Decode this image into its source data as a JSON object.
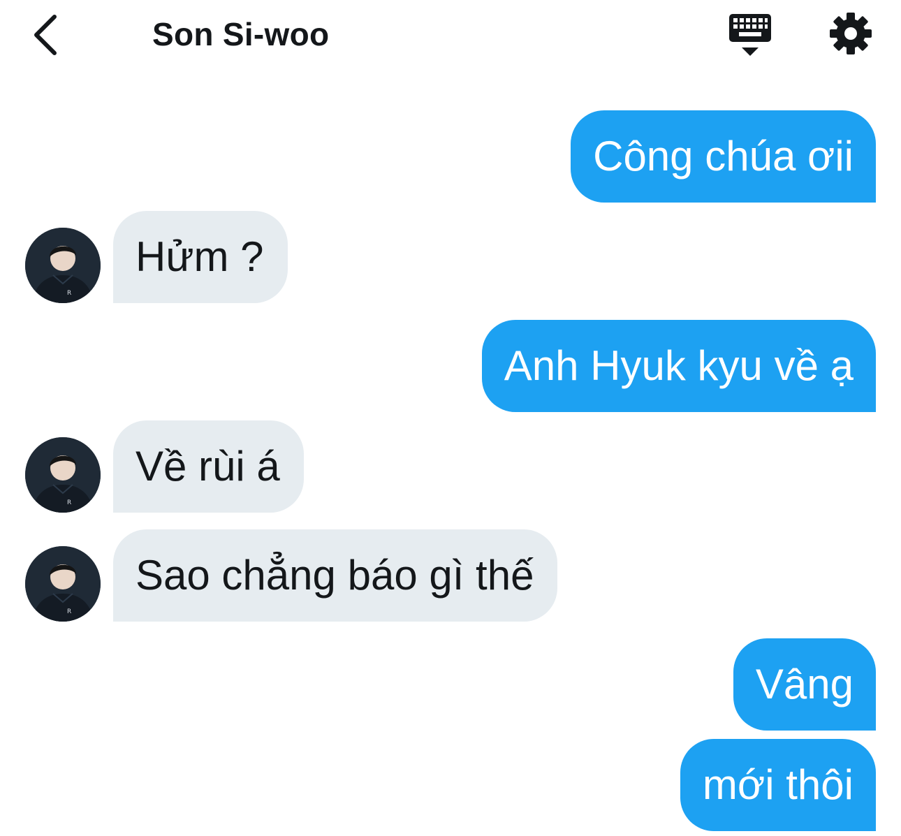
{
  "header": {
    "title": "Son Si-woo",
    "back_icon": "chevron-left-icon",
    "keyboard_icon": "keyboard-dismiss-icon",
    "settings_icon": "gear-icon"
  },
  "colors": {
    "sent_bubble": "#1da1f2",
    "received_bubble": "#e6ecf0",
    "text_dark": "#14171a",
    "text_light": "#ffffff"
  },
  "messages": [
    {
      "direction": "sent",
      "text": "Công chúa ơii"
    },
    {
      "direction": "received",
      "text": "Hửm ?"
    },
    {
      "direction": "sent",
      "text": "Anh Hyuk kyu về ạ"
    },
    {
      "direction": "received",
      "text": "Về rùi á"
    },
    {
      "direction": "received",
      "text": "Sao chẳng báo gì thế"
    },
    {
      "direction": "sent",
      "text": "Vâng"
    },
    {
      "direction": "sent",
      "text": "mới thôi"
    }
  ]
}
